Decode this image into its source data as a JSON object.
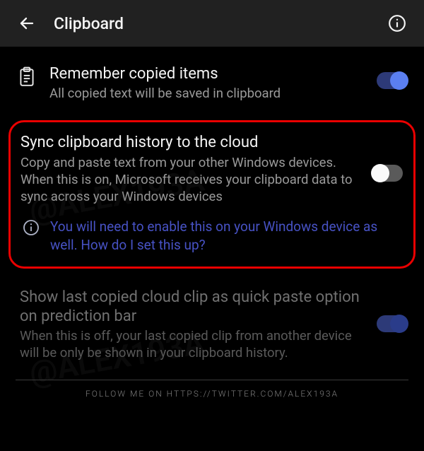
{
  "header": {
    "title": "Clipboard"
  },
  "settings": {
    "remember": {
      "title": "Remember copied items",
      "subtitle": "All copied text will be saved in clipboard",
      "enabled": true
    },
    "sync": {
      "title": "Sync clipboard history to the cloud",
      "subtitle": "Copy and paste text from your other Windows devices. When this is on, Microsoft receives your clipboard data to sync across your Windows devices",
      "info": "You will need to enable this on your Windows device as well. How do I set this up?",
      "enabled": false
    },
    "quickpaste": {
      "title": "Show last copied cloud clip as quick paste option on prediction bar",
      "subtitle": "When this is off, your last copied clip from another device will be only be shown in your clipboard history.",
      "enabled": true
    }
  },
  "watermark": "@ALEX193A",
  "footer": "FOLLOW ME ON HTTPS://TWITTER.COM/ALEX193A"
}
